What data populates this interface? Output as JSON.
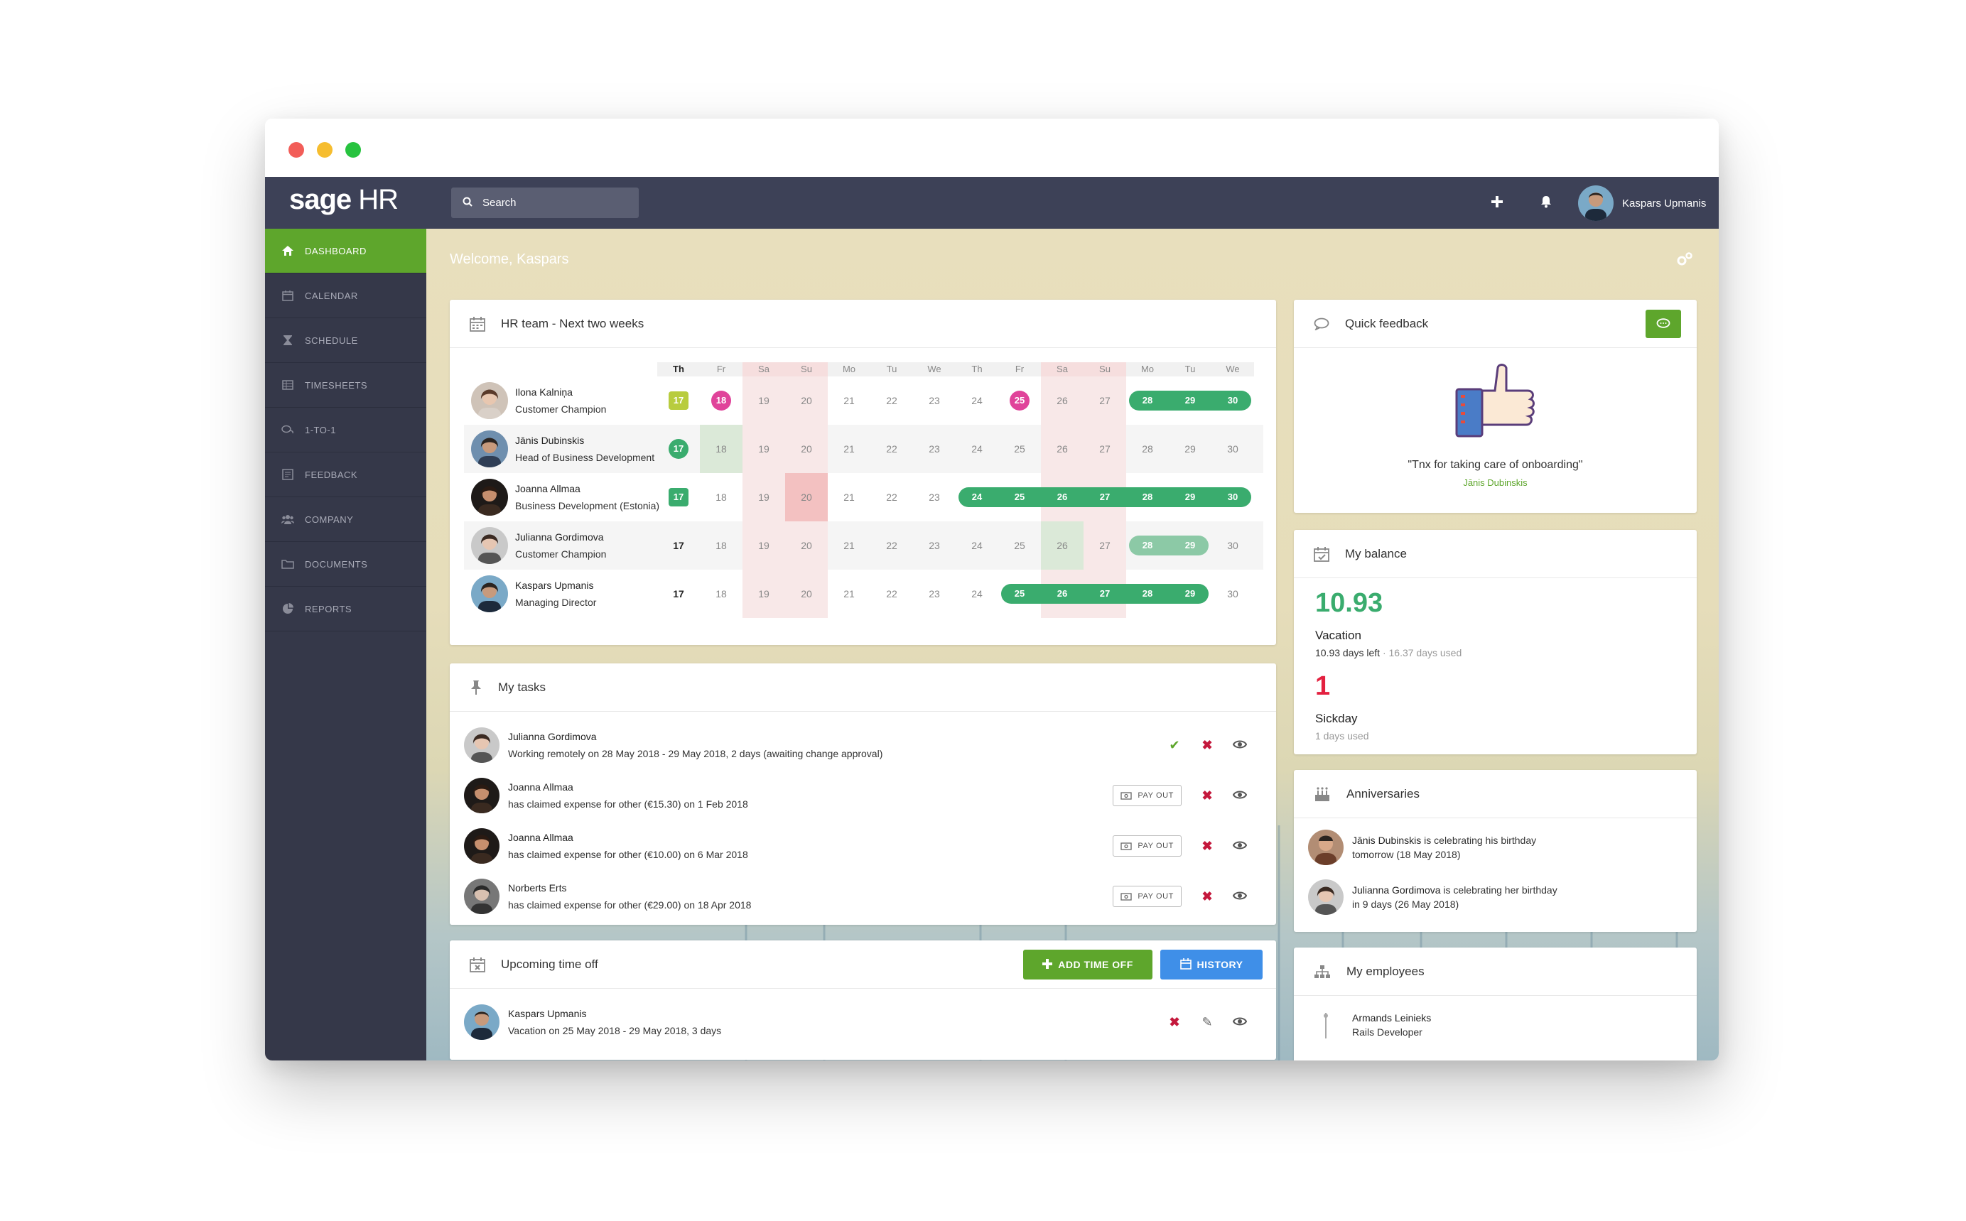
{
  "window": {
    "dots": [
      "#f25d58",
      "#f6bd2f",
      "#27c33f"
    ]
  },
  "topbar": {
    "logo_bold": "sage",
    "logo_light": " HR",
    "search_placeholder": "Search",
    "user_name": "Kaspars Upmanis",
    "icons": [
      "plus-icon",
      "bell-icon"
    ]
  },
  "sidebar": {
    "items": [
      {
        "label": "DASHBOARD",
        "icon": "home-icon",
        "active": true
      },
      {
        "label": "CALENDAR",
        "icon": "calendar-icon"
      },
      {
        "label": "SCHEDULE",
        "icon": "hourglass-icon"
      },
      {
        "label": "TIMESHEETS",
        "icon": "table-icon"
      },
      {
        "label": "1-TO-1",
        "icon": "chat-icon"
      },
      {
        "label": "FEEDBACK",
        "icon": "feedback-icon"
      },
      {
        "label": "COMPANY",
        "icon": "users-icon"
      },
      {
        "label": "DOCUMENTS",
        "icon": "folder-icon"
      },
      {
        "label": "REPORTS",
        "icon": "pie-chart-icon"
      }
    ]
  },
  "main": {
    "welcome": "Welcome, Kaspars",
    "accent_green": "#5ea62c",
    "team_calendar": {
      "title": "HR team - Next two weeks",
      "days": [
        {
          "label": "Th",
          "weekend": false,
          "today": true
        },
        {
          "label": "Fr",
          "weekend": false
        },
        {
          "label": "Sa",
          "weekend": true
        },
        {
          "label": "Su",
          "weekend": true
        },
        {
          "label": "Mo",
          "weekend": false
        },
        {
          "label": "Tu",
          "weekend": false
        },
        {
          "label": "We",
          "weekend": false
        },
        {
          "label": "Th",
          "weekend": false
        },
        {
          "label": "Fr",
          "weekend": false
        },
        {
          "label": "Sa",
          "weekend": true
        },
        {
          "label": "Su",
          "weekend": true
        },
        {
          "label": "Mo",
          "weekend": false
        },
        {
          "label": "Tu",
          "weekend": false
        },
        {
          "label": "We",
          "weekend": false
        }
      ],
      "dates": [
        "17",
        "18",
        "19",
        "20",
        "21",
        "22",
        "23",
        "24",
        "25",
        "26",
        "27",
        "28",
        "29",
        "30"
      ],
      "people": [
        {
          "name": "Ilona Kalniņa",
          "role": "Customer Champion",
          "today_badge": "square",
          "markers": [
            {
              "date": "18",
              "style": "pink"
            },
            {
              "date": "25",
              "style": "pink"
            }
          ],
          "pill": [
            "28",
            "29",
            "30"
          ],
          "pill_light": false,
          "shaded": false,
          "cells_green": [],
          "cells_red": []
        },
        {
          "name": "Jānis Dubinskis",
          "role": "Head of Business Development",
          "today_badge": "circle",
          "markers": [],
          "pill": [],
          "pill_light": false,
          "shaded": true,
          "cells_green": [
            "18"
          ],
          "cells_red": []
        },
        {
          "name": "Joanna Allmaa",
          "role": "Business Development (Estonia)",
          "today_badge": "square-green",
          "markers": [],
          "pill": [
            "24",
            "25",
            "26",
            "27",
            "28",
            "29",
            "30"
          ],
          "pill_light": false,
          "shaded": false,
          "cells_green": [],
          "cells_red": [
            "20"
          ]
        },
        {
          "name": "Julianna Gordimova",
          "role": "Customer Champion",
          "today_badge": "none",
          "markers": [],
          "pill": [
            "28",
            "29"
          ],
          "pill_light": true,
          "shaded": true,
          "cells_green": [
            "26"
          ],
          "cells_red": []
        },
        {
          "name": "Kaspars Upmanis",
          "role": "Managing Director",
          "today_badge": "none",
          "markers": [],
          "pill": [
            "25",
            "26",
            "27",
            "28",
            "29"
          ],
          "pill_light": false,
          "shaded": false,
          "cells_green": [],
          "cells_red": []
        }
      ]
    },
    "tasks": {
      "title": "My tasks",
      "pay_out_label": "PAY OUT",
      "items": [
        {
          "name": "Julianna Gordimova",
          "desc": "Working remotely on 28 May 2018 - 29 May 2018, 2 days (awaiting change approval)",
          "type": "approve"
        },
        {
          "name": "Joanna Allmaa",
          "desc": "has claimed expense for other (€15.30) on 1 Feb 2018",
          "type": "payout"
        },
        {
          "name": "Joanna Allmaa",
          "desc": "has claimed expense for other (€10.00) on 6 Mar 2018",
          "type": "payout"
        },
        {
          "name": "Norberts Erts",
          "desc": "has claimed expense for other (€29.00) on 18 Apr 2018",
          "type": "payout"
        }
      ]
    },
    "timeoff": {
      "title": "Upcoming time off",
      "add_label": "ADD TIME OFF",
      "history_label": "HISTORY",
      "items": [
        {
          "name": "Kaspars Upmanis",
          "desc": "Vacation on 25 May 2018 - 29 May 2018, 3 days"
        }
      ]
    },
    "feedback": {
      "title": "Quick feedback",
      "quote": "\"Tnx for taking care of onboarding\"",
      "author": "Jānis Dubinskis"
    },
    "balance": {
      "title": "My balance",
      "vacation_value": "10.93",
      "vacation_label": "Vacation",
      "vacation_left": "10.93 days left",
      "vacation_used": "· 16.37 days used",
      "sick_value": "1",
      "sick_label": "Sickday",
      "sick_used": "1 days used",
      "vacation_color": "#3aac6e",
      "sick_color": "#e3203f"
    },
    "anniversaries": {
      "title": "Anniversaries",
      "items": [
        {
          "name": "Jānis Dubinskis",
          "text": " is celebrating his birthday",
          "when": "tomorrow (18 May 2018)"
        },
        {
          "name": "Julianna Gordimova",
          "text": " is celebrating her birthday",
          "when": "in 9 days (26 May 2018)"
        }
      ]
    },
    "employees": {
      "title": "My employees",
      "items": [
        {
          "name": "Armands Leinieks",
          "role": "Rails Developer"
        }
      ]
    }
  }
}
